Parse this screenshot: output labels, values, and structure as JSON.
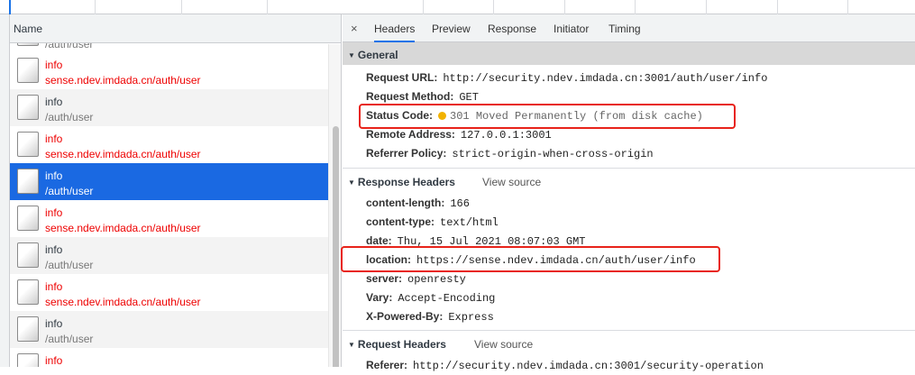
{
  "list": {
    "header": "Name",
    "partial_top": "/auth/user",
    "rows": [
      {
        "name": "info",
        "path": "sense.ndev.imdada.cn/auth/user",
        "state": "err"
      },
      {
        "name": "info",
        "path": "/auth/user",
        "state": "ok"
      },
      {
        "name": "info",
        "path": "sense.ndev.imdada.cn/auth/user",
        "state": "err"
      },
      {
        "name": "info",
        "path": "/auth/user",
        "state": "sel"
      },
      {
        "name": "info",
        "path": "sense.ndev.imdada.cn/auth/user",
        "state": "err"
      },
      {
        "name": "info",
        "path": "/auth/user",
        "state": "ok"
      },
      {
        "name": "info",
        "path": "sense.ndev.imdada.cn/auth/user",
        "state": "err"
      },
      {
        "name": "info",
        "path": "/auth/user",
        "state": "ok"
      },
      {
        "name": "info",
        "path": "",
        "state": "err"
      }
    ]
  },
  "tabs": {
    "close": "×",
    "items": [
      "Headers",
      "Preview",
      "Response",
      "Initiator",
      "Timing"
    ],
    "active": "Headers"
  },
  "general": {
    "title": "General",
    "request_url": {
      "k": "Request URL:",
      "v": "http://security.ndev.imdada.cn:3001/auth/user/info"
    },
    "request_method": {
      "k": "Request Method:",
      "v": "GET"
    },
    "status_code": {
      "k": "Status Code:",
      "v": "301 Moved Permanently (from disk cache)",
      "dot_color": "#f2b200"
    },
    "remote_address": {
      "k": "Remote Address:",
      "v": "127.0.0.1:3001"
    },
    "referrer_policy": {
      "k": "Referrer Policy:",
      "v": "strict-origin-when-cross-origin"
    }
  },
  "response_headers": {
    "title": "Response Headers",
    "view_source": "View source",
    "items": [
      {
        "k": "content-length:",
        "v": "166"
      },
      {
        "k": "content-type:",
        "v": "text/html"
      },
      {
        "k": "date:",
        "v": "Thu, 15 Jul 2021 08:07:03 GMT"
      },
      {
        "k": "location:",
        "v": "https://sense.ndev.imdada.cn/auth/user/info"
      },
      {
        "k": "server:",
        "v": "openresty"
      },
      {
        "k": "Vary:",
        "v": "Accept-Encoding"
      },
      {
        "k": "X-Powered-By:",
        "v": "Express"
      }
    ]
  },
  "request_headers": {
    "title": "Request Headers",
    "view_source": "View source",
    "items": [
      {
        "k": "Referer:",
        "v": "http://security.ndev.imdada.cn:3001/security-operation"
      }
    ]
  },
  "colors": {
    "accent": "#1a73e8",
    "selected_row": "#1a69e2",
    "error_text": "#ee0000",
    "highlight_box": "#e8231a"
  }
}
